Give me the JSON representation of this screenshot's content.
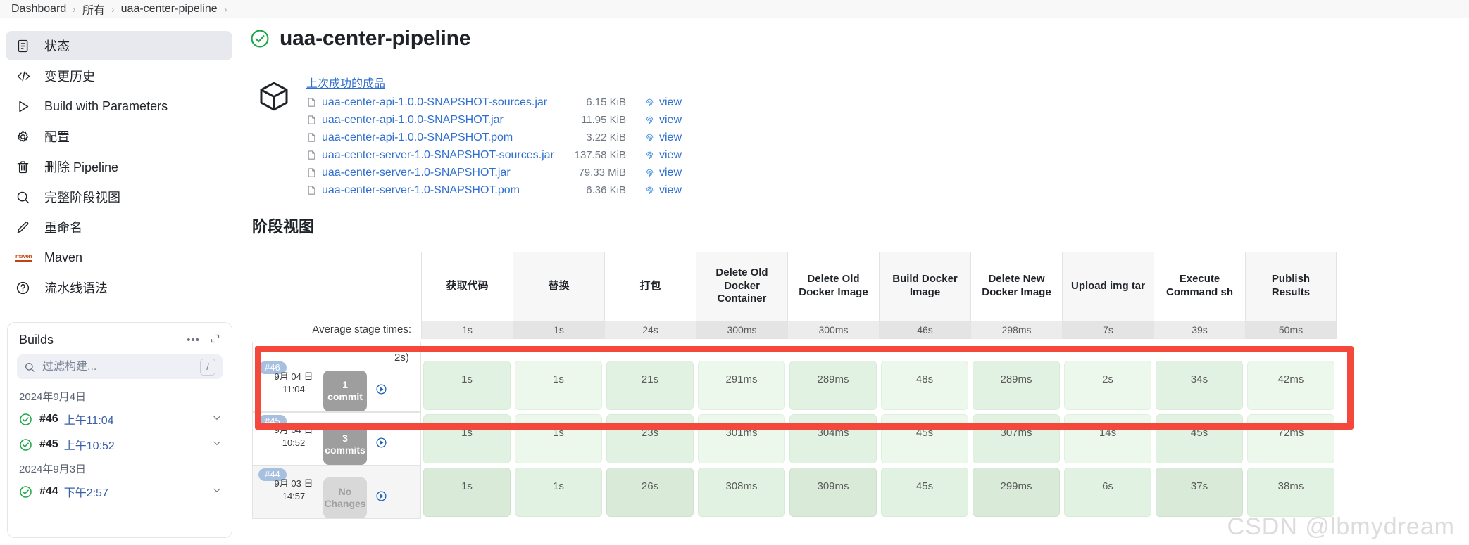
{
  "breadcrumb": {
    "items": [
      "Dashboard",
      "所有",
      "uaa-center-pipeline"
    ],
    "separator": "›"
  },
  "sidebar": {
    "items": [
      {
        "label": "状态",
        "icon": "document-icon",
        "active": true
      },
      {
        "label": "变更历史",
        "icon": "code-icon",
        "active": false
      },
      {
        "label": "Build with Parameters",
        "icon": "play-icon",
        "active": false
      },
      {
        "label": "配置",
        "icon": "gear-icon",
        "active": false
      },
      {
        "label": "删除 Pipeline",
        "icon": "trash-icon",
        "active": false
      },
      {
        "label": "完整阶段视图",
        "icon": "search-icon",
        "active": false
      },
      {
        "label": "重命名",
        "icon": "pencil-icon",
        "active": false
      },
      {
        "label": "Maven",
        "icon": "maven-icon",
        "active": false
      },
      {
        "label": "流水线语法",
        "icon": "question-icon",
        "active": false
      }
    ]
  },
  "builds_panel": {
    "title": "Builds",
    "more_icon": "ellipsis-icon",
    "expand_icon": "expand-icon",
    "search_placeholder": "过滤构建...",
    "search_value": "",
    "shortcut_key": "/",
    "groups": [
      {
        "date": "2024年9月4日",
        "builds": [
          {
            "number": "#46",
            "time": "上午11:04",
            "status": "success"
          },
          {
            "number": "#45",
            "time": "上午10:52",
            "status": "success"
          }
        ]
      },
      {
        "date": "2024年9月3日",
        "builds": [
          {
            "number": "#44",
            "time": "下午2:57",
            "status": "success"
          }
        ]
      }
    ]
  },
  "main": {
    "title": "uaa-center-pipeline",
    "status_icon": "success-check-icon",
    "artifacts": {
      "heading": "上次成功的成品",
      "cube_icon": "package-icon",
      "view_label": "view",
      "rows": [
        {
          "name": "uaa-center-api-1.0.0-SNAPSHOT-sources.jar",
          "size": "6.15 KiB"
        },
        {
          "name": "uaa-center-api-1.0.0-SNAPSHOT.jar",
          "size": "11.95 KiB"
        },
        {
          "name": "uaa-center-api-1.0.0-SNAPSHOT.pom",
          "size": "3.22 KiB"
        },
        {
          "name": "uaa-center-server-1.0-SNAPSHOT-sources.jar",
          "size": "137.58 KiB"
        },
        {
          "name": "uaa-center-server-1.0-SNAPSHOT.jar",
          "size": "79.33 MiB"
        },
        {
          "name": "uaa-center-server-1.0-SNAPSHOT.pom",
          "size": "6.36 KiB"
        }
      ]
    },
    "stage_view": {
      "title": "阶段视图",
      "average_label": "Average stage times:",
      "partial_duration": "2s)",
      "stages": [
        "获取代码",
        "替换",
        "打包",
        "Delete Old Docker Container",
        "Delete Old Docker Image",
        "Build Docker Image",
        "Delete New Docker Image",
        "Upload img tar",
        "Execute Command sh",
        "Publish Results"
      ],
      "average_times": [
        "1s",
        "1s",
        "24s",
        "300ms",
        "300ms",
        "46s",
        "298ms",
        "7s",
        "39s",
        "50ms"
      ],
      "runs": [
        {
          "badge": "#46",
          "date": "9月 04 日",
          "time": "11:04",
          "changes": "1",
          "changes_unit": "commit",
          "no_changes": false,
          "play_icon": "replay-icon",
          "times": [
            "1s",
            "1s",
            "21s",
            "291ms",
            "289ms",
            "48s",
            "289ms",
            "2s",
            "34s",
            "42ms"
          ],
          "highlighted": true
        },
        {
          "badge": "#45",
          "date": "9月 04 日",
          "time": "10:52",
          "changes": "3",
          "changes_unit": "commits",
          "no_changes": false,
          "play_icon": "replay-icon",
          "times": [
            "1s",
            "1s",
            "23s",
            "301ms",
            "304ms",
            "45s",
            "307ms",
            "14s",
            "45s",
            "72ms"
          ],
          "highlighted": false
        },
        {
          "badge": "#44",
          "date": "9月 03 日",
          "time": "14:57",
          "changes": "No",
          "changes_unit": "Changes",
          "no_changes": true,
          "play_icon": "replay-icon",
          "times": [
            "1s",
            "1s",
            "26s",
            "308ms",
            "309ms",
            "45s",
            "299ms",
            "6s",
            "37s",
            "38ms"
          ],
          "highlighted": false
        }
      ]
    }
  },
  "annotation": {
    "highlight_color": "#f4483c"
  },
  "watermark": "CSDN @lbmydream"
}
